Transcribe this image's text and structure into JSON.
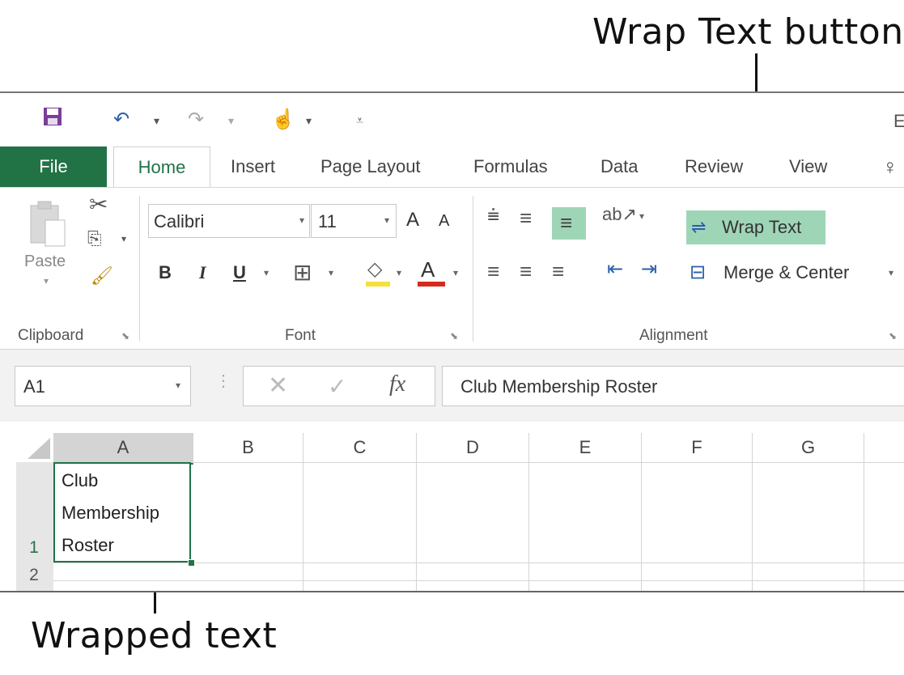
{
  "callouts": {
    "top": "Wrap Text button",
    "bottom": "Wrapped text"
  },
  "qat": {
    "save_icon": "save-icon",
    "undo_icon": "undo-icon",
    "redo_icon": "redo-icon",
    "touch_icon": "touch-mode-icon",
    "customize_icon": "customize-qat-icon",
    "title_fragment": "E"
  },
  "tabs": [
    "File",
    "Home",
    "Insert",
    "Page Layout",
    "Formulas",
    "Data",
    "Review",
    "View"
  ],
  "ribbon": {
    "clipboard": {
      "paste_label": "Paste",
      "group_label": "Clipboard"
    },
    "font": {
      "font_name": "Calibri",
      "font_size": "11",
      "bold": "B",
      "italic": "I",
      "underline": "U",
      "grow": "A",
      "shrink": "A",
      "font_color": "A",
      "group_label": "Font"
    },
    "alignment": {
      "wrap_text": "Wrap Text",
      "merge_center": "Merge & Center",
      "group_label": "Alignment"
    }
  },
  "formula_bar": {
    "name_box": "A1",
    "fx": "fx",
    "content": "Club Membership Roster"
  },
  "grid": {
    "columns": [
      "A",
      "B",
      "C",
      "D",
      "E",
      "F",
      "G"
    ],
    "rows": [
      "1",
      "2"
    ],
    "a1_lines": [
      "Club",
      "Membership",
      "Roster"
    ]
  },
  "colors": {
    "accent": "#217346",
    "wrap_highlight": "#9fd5b7",
    "highlight_yellow": "#f5e03a",
    "font_red": "#d52b1e"
  }
}
